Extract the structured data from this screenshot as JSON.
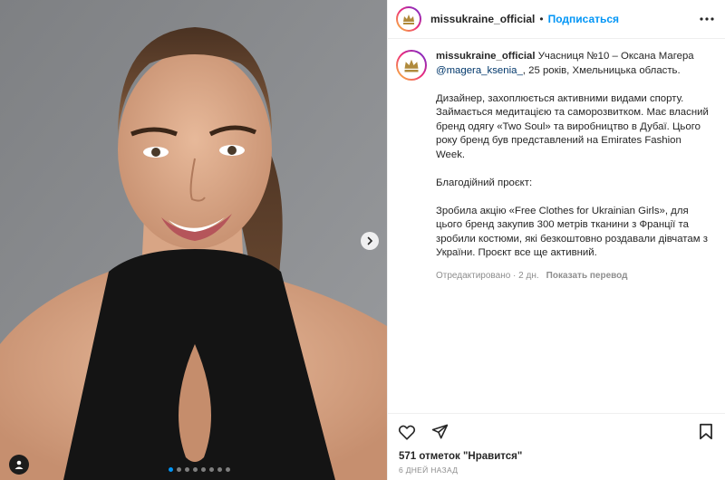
{
  "post": {
    "account": "missukraine_official",
    "separator": "•",
    "follow_label": "Подписаться",
    "caption": {
      "username": "missukraine_official",
      "line1": " Учасниця №10 – Оксана Магера ",
      "mention": "@magera_ksenia_",
      "line1_tail": ", 25 років, Хмельницька область.",
      "paragraph2": "Дизайнер, захоплюється активними видами спорту. Займається медитацією та саморозвитком. Має власний бренд одягу «Two Soul» та виробництво в Дубаї. Цього року бренд був представлений на Emirates Fashion Week.",
      "paragraph3": "Благодійний проєкт:",
      "paragraph4": "Зробила акцію «Free Clothes for Ukrainian Girls», для цього бренд закупив 300 метрів тканини з Франції та зробили костюми, які безкоштовно роздавали дівчатам з України. Проєкт все ще активний."
    },
    "meta_edited": "Отредактировано · 2 дн.",
    "translate_label": "Показать перевод",
    "likes": "571 отметок \"Нравится\"",
    "time": "6 дней назад",
    "carousel": {
      "count": 8,
      "active_index": 0
    },
    "colors": {
      "accent": "#0095f6",
      "link": "#00376b",
      "muted": "#8e8e8e",
      "photo_background": "#8a8c8f"
    },
    "icons": [
      "crown-logo-icon",
      "more-options-icon",
      "chevron-right-icon",
      "user-tag-icon",
      "heart-icon",
      "share-icon",
      "bookmark-icon"
    ]
  }
}
